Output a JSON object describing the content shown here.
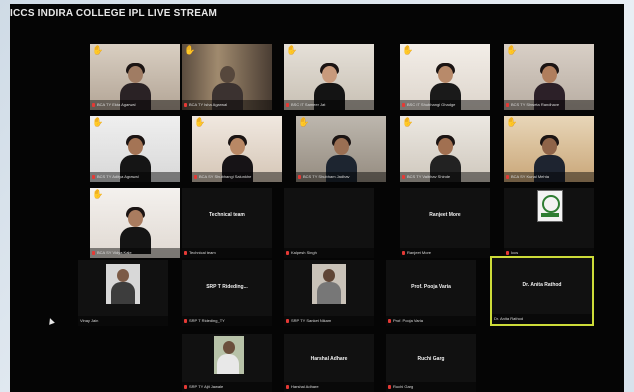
{
  "window": {
    "title": "ICCS INDIRA COLLEGE IPL LIVE STREAM"
  },
  "colors": {
    "background": "#050505",
    "hand_raise": "#f5c518",
    "muted_mic": "#e53935",
    "active_speaker_border": "#cddc39"
  },
  "participants": [
    {
      "name": "Ekta Agarwal",
      "label": "BCA TY Ekta Agarwal",
      "hand_raised": true,
      "kind": "video"
    },
    {
      "name": "Isha Agarwal",
      "label": "BCA TY Isha Agarwal",
      "hand_raised": true,
      "kind": "video"
    },
    {
      "name": "Sameer Jat",
      "label": "BSC IT Sameer Jat",
      "hand_raised": true,
      "kind": "video"
    },
    {
      "name": "Shubhangi Ghadge",
      "label": "BSC IT Shubhangi Ghadge",
      "hand_raised": true,
      "kind": "video"
    },
    {
      "name": "Shweta Randhave",
      "label": "BCS TY Shweta Randhave",
      "hand_raised": true,
      "kind": "video"
    },
    {
      "name": "Aditya Agrawal",
      "label": "BCS TY Aditya Agrawal",
      "hand_raised": true,
      "kind": "video"
    },
    {
      "name": "Shubhangi Salunkhe",
      "label": "BCA SY Shubhangi Salunkhe",
      "hand_raised": true,
      "kind": "video"
    },
    {
      "name": "Shubham Jadhav",
      "label": "BCS TY Shubham Jadhav",
      "hand_raised": true,
      "kind": "video"
    },
    {
      "name": "Vaibhav Shinde",
      "label": "BCS TY Vaibhav Shinde",
      "hand_raised": true,
      "kind": "video"
    },
    {
      "name": "Kunal Mehta",
      "label": "BCA SY Kunal Mehta",
      "hand_raised": true,
      "kind": "video"
    },
    {
      "name": "Vidya Kale",
      "label": "BCA SY Vidya Kale",
      "hand_raised": true,
      "kind": "video"
    },
    {
      "name": "Technical team",
      "label": "Technical team",
      "hand_raised": false,
      "kind": "name"
    },
    {
      "name": "Kalpesh Singh",
      "label": "Kalpesh Singh",
      "hand_raised": false,
      "kind": "blank"
    },
    {
      "name": "Ranjeet More",
      "label": "Ranjeet More",
      "hand_raised": false,
      "kind": "name"
    },
    {
      "name": "Iccs",
      "label": "Iccs",
      "hand_raised": false,
      "kind": "logo"
    },
    {
      "name": "Vinay Jain",
      "label": "Vinay Jain",
      "hand_raised": false,
      "kind": "avatar",
      "muted": false
    },
    {
      "name": "SRP T Rideding...",
      "label": "SRP T Rideding_TY",
      "hand_raised": false,
      "kind": "name"
    },
    {
      "name": "Sanket Nikam",
      "label": "SRP TY Sanket Nikam",
      "hand_raised": false,
      "kind": "avatar"
    },
    {
      "name": "Prof. Pooja Varia",
      "label": "Prof. Pooja Varia",
      "hand_raised": false,
      "kind": "name"
    },
    {
      "name": "Dr. Anita Rathod",
      "label": "Dr. Anita Rathod",
      "hand_raised": false,
      "kind": "name",
      "active": true
    },
    {
      "name": "Ajit Jawale",
      "label": "SRP TY Ajit Jawale",
      "hand_raised": false,
      "kind": "avatar"
    },
    {
      "name": "Harshal Adhare",
      "label": "Harshal Adhare",
      "hand_raised": false,
      "kind": "name"
    },
    {
      "name": "Ruchi Garg",
      "label": "Ruchi Garg",
      "hand_raised": false,
      "kind": "name"
    }
  ]
}
